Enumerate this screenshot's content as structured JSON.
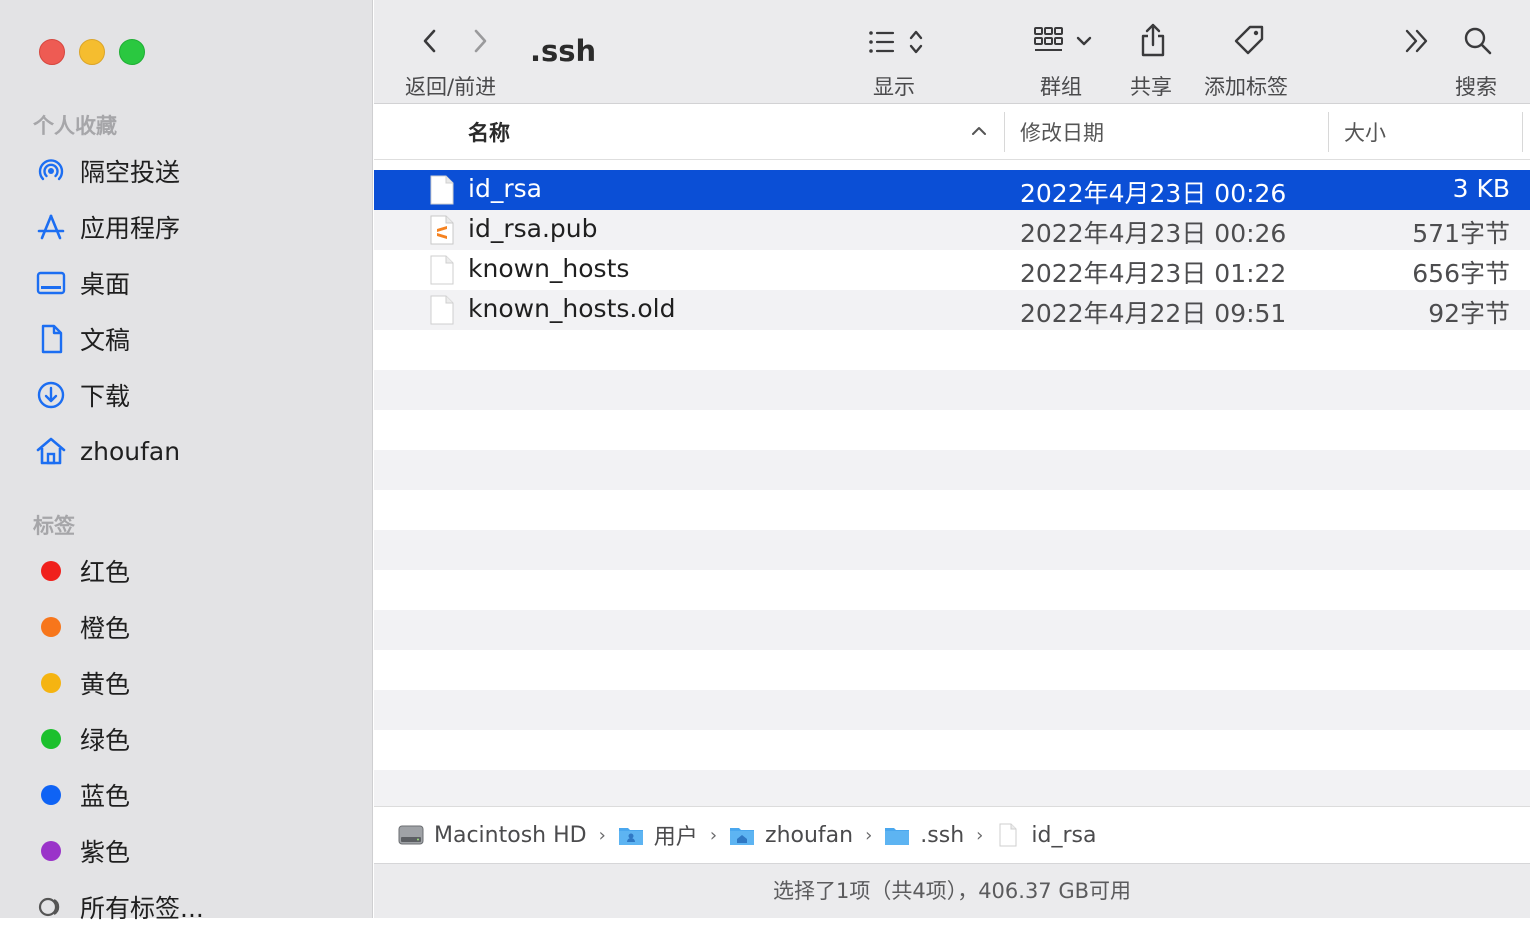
{
  "toolbar": {
    "title": ".ssh",
    "nav_label": "返回/前进",
    "view_label": "显示",
    "group_label": "群组",
    "share_label": "共享",
    "tag_label": "添加标签",
    "search_label": "搜索"
  },
  "sidebar": {
    "favorites_title": "个人收藏",
    "favorites": [
      {
        "label": "隔空投送",
        "icon": "airdrop-icon"
      },
      {
        "label": "应用程序",
        "icon": "applications-icon"
      },
      {
        "label": "桌面",
        "icon": "desktop-icon"
      },
      {
        "label": "文稿",
        "icon": "document-icon"
      },
      {
        "label": "下载",
        "icon": "download-icon"
      },
      {
        "label": "zhoufan",
        "icon": "home-icon"
      }
    ],
    "tags_title": "标签",
    "tags": [
      {
        "label": "红色",
        "color": "#f0201c"
      },
      {
        "label": "橙色",
        "color": "#f7761b"
      },
      {
        "label": "黄色",
        "color": "#f5b411"
      },
      {
        "label": "绿色",
        "color": "#1bc02c"
      },
      {
        "label": "蓝色",
        "color": "#0f63f5"
      },
      {
        "label": "紫色",
        "color": "#9a33c9"
      }
    ],
    "all_tags": "所有标签..."
  },
  "columns": {
    "name": "名称",
    "date": "修改日期",
    "size": "大小"
  },
  "files": [
    {
      "name": "id_rsa",
      "date": "2022年4月23日 00:26",
      "size": "3 KB",
      "icon": "file-icon",
      "selected": true
    },
    {
      "name": "id_rsa.pub",
      "date": "2022年4月23日 00:26",
      "size": "571字节",
      "icon": "sublime-file-icon",
      "selected": false
    },
    {
      "name": "known_hosts",
      "date": "2022年4月23日 01:22",
      "size": "656字节",
      "icon": "file-icon",
      "selected": false
    },
    {
      "name": "known_hosts.old",
      "date": "2022年4月22日 09:51",
      "size": "92字节",
      "icon": "file-icon",
      "selected": false
    }
  ],
  "pathbar": [
    {
      "label": "Macintosh HD",
      "icon": "disk-icon"
    },
    {
      "label": "用户",
      "icon": "users-folder-icon"
    },
    {
      "label": "zhoufan",
      "icon": "home-folder-icon"
    },
    {
      "label": ".ssh",
      "icon": "folder-icon"
    },
    {
      "label": "id_rsa",
      "icon": "file-icon"
    }
  ],
  "status": "选择了1项（共4项），406.37 GB可用",
  "colors": {
    "selection": "#0b4fd6",
    "accent": "#1c6ef2"
  }
}
